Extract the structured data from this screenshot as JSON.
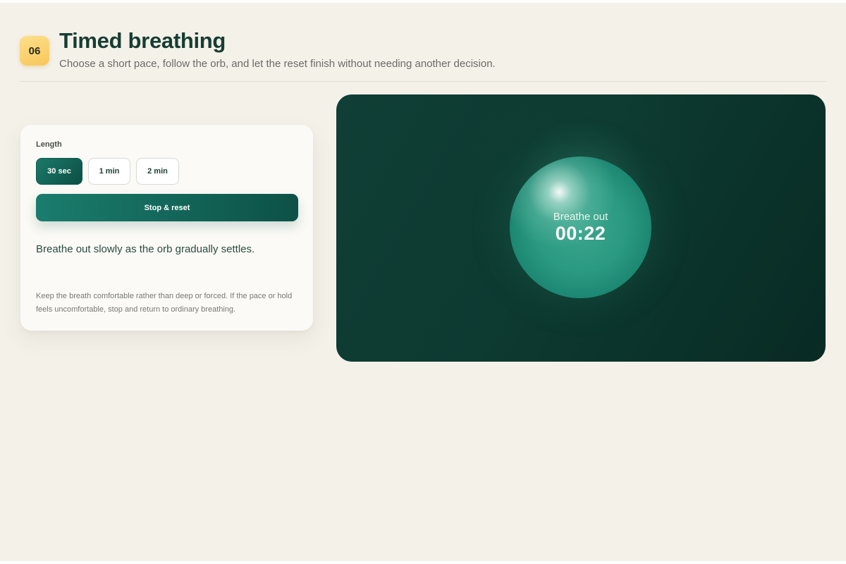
{
  "header": {
    "step_badge": "06",
    "title": "Timed breathing",
    "subtitle": "Choose a short pace, follow the orb, and let the reset finish without needing another decision."
  },
  "controls": {
    "length_label": "Length",
    "options": [
      {
        "label": "30 sec",
        "selected": true
      },
      {
        "label": "1 min",
        "selected": false
      },
      {
        "label": "2 min",
        "selected": false
      }
    ],
    "stop_button": "Stop & reset",
    "instruction": "Breathe out slowly as the orb gradually settles.",
    "note": "Keep the breath comfortable rather than deep or forced. If the pace or hold feels uncomfortable, stop and return to ordinary breathing."
  },
  "orb": {
    "phase": "Breathe out",
    "timer": "00:22"
  },
  "colors": {
    "background": "#f4f1e9",
    "accent": "#0f5a4e",
    "badge": "#f7c65a",
    "stage": "#0d3a31",
    "orb": "#2b9a82"
  }
}
